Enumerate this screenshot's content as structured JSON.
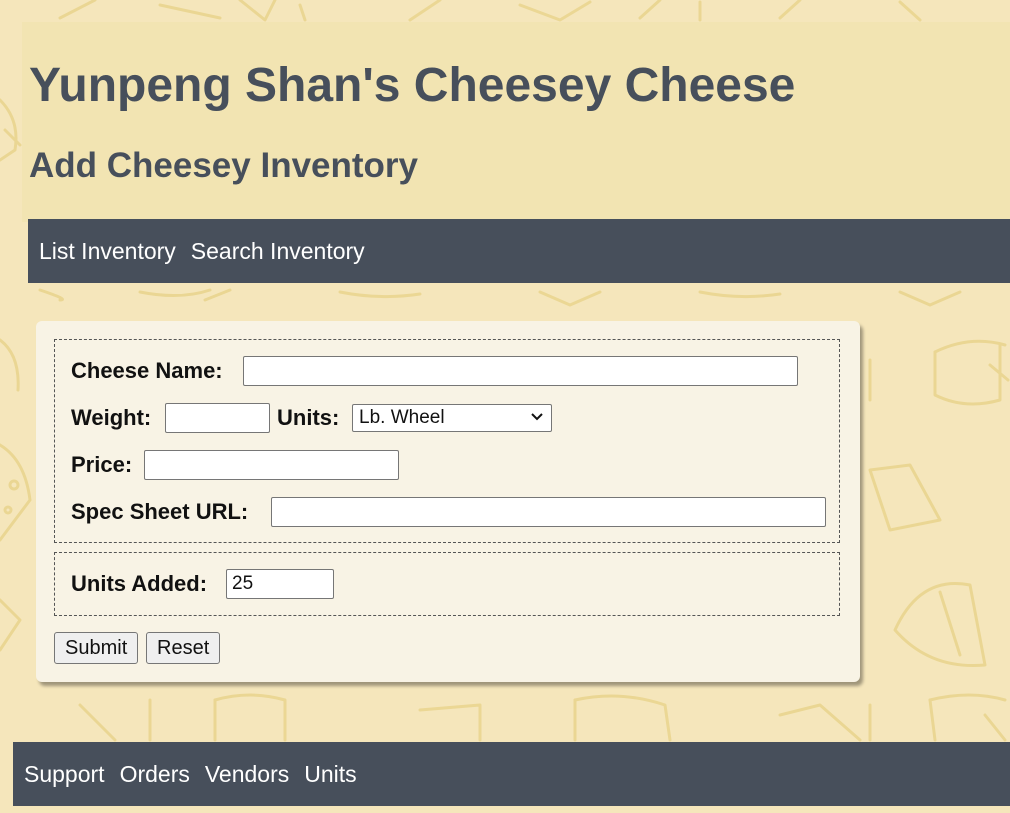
{
  "header": {
    "site_title": "Yunpeng Shan's Cheesey Cheese",
    "page_title": "Add Cheesey Inventory"
  },
  "top_nav": {
    "items": [
      {
        "label": "List Inventory"
      },
      {
        "label": "Search Inventory"
      }
    ]
  },
  "form": {
    "cheese_name": {
      "label": "Cheese Name:",
      "value": ""
    },
    "weight": {
      "label": "Weight:",
      "value": ""
    },
    "units": {
      "label": "Units:",
      "selected": "Lb. Wheel"
    },
    "price": {
      "label": "Price:",
      "value": ""
    },
    "spec_sheet": {
      "label": "Spec Sheet URL:",
      "value": ""
    },
    "units_added": {
      "label": "Units Added:",
      "value": "25"
    },
    "submit_label": "Submit",
    "reset_label": "Reset"
  },
  "footer_nav": {
    "items": [
      {
        "label": "Support"
      },
      {
        "label": "Orders"
      },
      {
        "label": "Vendors"
      },
      {
        "label": "Units"
      }
    ]
  },
  "colors": {
    "background": "#f5e6bb",
    "header_panel": "#f2e4b2",
    "nav_bar": "#474f5b",
    "title_text": "#474f5b",
    "card": "#f8f3e5",
    "pattern_stroke": "#e7cf83"
  },
  "icons": {
    "background_pattern": "cheese-wedge-pattern",
    "select_arrow": "chevron-down-icon"
  }
}
